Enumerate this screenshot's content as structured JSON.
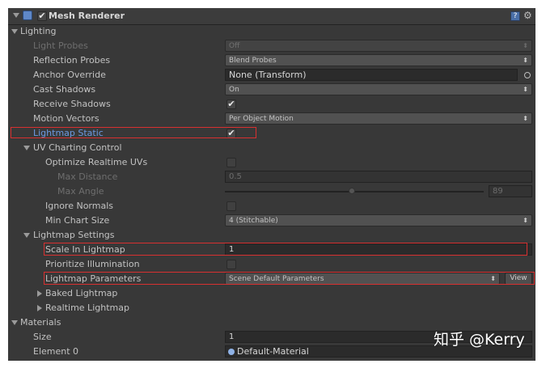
{
  "component": {
    "title": "Mesh Renderer",
    "enabled": true,
    "help_icon": "help-icon",
    "settings_icon": "gear-icon"
  },
  "lighting": {
    "header": "Lighting",
    "light_probes": {
      "label": "Light Probes",
      "value": "Off"
    },
    "reflection_probes": {
      "label": "Reflection Probes",
      "value": "Blend Probes"
    },
    "anchor_override": {
      "label": "Anchor Override",
      "value": "None (Transform)"
    },
    "cast_shadows": {
      "label": "Cast Shadows",
      "value": "On"
    },
    "receive_shadows": {
      "label": "Receive Shadows",
      "checked": true
    },
    "motion_vectors": {
      "label": "Motion Vectors",
      "value": "Per Object Motion"
    },
    "lightmap_static": {
      "label": "Lightmap Static",
      "checked": true
    },
    "uv_charting": {
      "header": "UV Charting Control",
      "optimize_realtime_uvs": {
        "label": "Optimize Realtime UVs",
        "checked": false
      },
      "max_distance": {
        "label": "Max Distance",
        "value": "0.5"
      },
      "max_angle": {
        "label": "Max Angle",
        "value": "89",
        "slider_fraction": 0.49
      },
      "ignore_normals": {
        "label": "Ignore Normals",
        "checked": false
      },
      "min_chart_size": {
        "label": "Min Chart Size",
        "value": "4 (Stitchable)"
      }
    },
    "lightmap_settings": {
      "header": "Lightmap Settings",
      "scale_in_lightmap": {
        "label": "Scale In Lightmap",
        "value": "1"
      },
      "prioritize_illumination": {
        "label": "Prioritize Illumination",
        "checked": false
      },
      "lightmap_parameters": {
        "label": "Lightmap Parameters",
        "value": "Scene Default Parameters",
        "view_label": "View"
      },
      "baked_lightmap": "Baked Lightmap",
      "realtime_lightmap": "Realtime Lightmap"
    }
  },
  "materials": {
    "header": "Materials",
    "size": {
      "label": "Size",
      "value": "1"
    },
    "element0": {
      "label": "Element 0",
      "value": "Default-Material"
    }
  },
  "watermark": "知乎 @Kerry",
  "colors": {
    "highlight_box": "#d83030",
    "lightmap_static_label": "#6a9ae2",
    "panel_bg": "#383838"
  }
}
